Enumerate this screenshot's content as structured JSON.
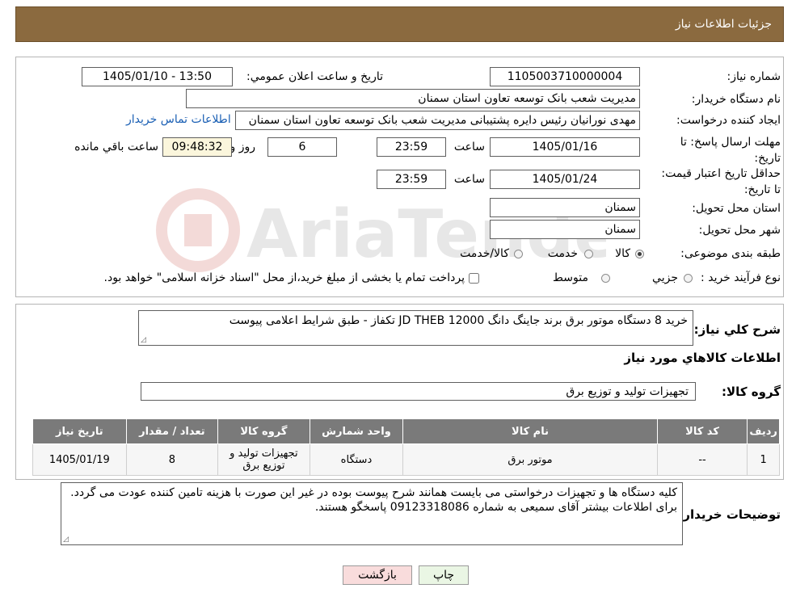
{
  "header": {
    "title": "جزئیات اطلاعات نیاز"
  },
  "form": {
    "need_number_label": "شماره نیاز:",
    "need_number": "1105003710000004",
    "announce_label": "تاریخ و ساعت اعلان عمومي:",
    "announce_value": "1405/01/10 - 13:50",
    "buyer_org_label": "نام دستگاه خریدار:",
    "buyer_org": "مدیریت شعب بانک توسعه تعاون استان سمنان",
    "creator_label": "ایجاد کننده درخواست:",
    "creator": "مهدی نورانیان رئیس دایره پشتیبانی مدیریت شعب بانک توسعه تعاون استان سمنان",
    "contact_link": "اطلاعات تماس خریدار",
    "deadline_label": "مهلت ارسال پاسخ: تا تاریخ:",
    "deadline_date": "1405/01/16",
    "time_label": "ساعت",
    "deadline_time": "23:59",
    "days_value": "6",
    "days_label": "روز و",
    "remaining_time": "09:48:32",
    "remaining_label": "ساعت باقي مانده",
    "validity_label": "حداقل تاریخ اعتبار قیمت: تا تاریخ:",
    "validity_date": "1405/01/24",
    "validity_time": "23:59",
    "province_label": "استان محل تحویل:",
    "province": "سمنان",
    "city_label": "شهر محل تحویل:",
    "city": "سمنان",
    "category_label": "طبقه بندی موضوعی:",
    "category_options": [
      "کالا",
      "خدمت",
      "کالا/خدمت"
    ],
    "process_label": "نوع فرآیند خرید :",
    "process_options": [
      "جزيي",
      "متوسط"
    ],
    "process_note": "پرداخت تمام یا بخشی از مبلغ خرید،از محل \"اسناد خزانه اسلامی\" خواهد بود."
  },
  "description": {
    "label": "شرح کلي نیاز:",
    "text": "خرید 8 دستگاه موتور برق برند جاینگ دانگ JD   THEB 12000 تکفاز -  طبق شرایط اعلامی پیوست"
  },
  "goods": {
    "section_title": "اطلاعات کالاهاي مورد نیاز",
    "group_label": "گروه کالا:",
    "group_value": "تجهیزات تولید و توزیع برق",
    "columns": [
      "ردیف",
      "کد کالا",
      "نام کالا",
      "واحد شمارش",
      "گروه کالا",
      "تعداد / مقدار",
      "تاریخ نیاز"
    ],
    "rows": [
      [
        "1",
        "--",
        "موتور برق",
        "دستگاه",
        "تجهیزات تولید و توزیع برق",
        "8",
        "1405/01/19"
      ]
    ]
  },
  "buyer_notes": {
    "label": "توضیحات خریدار:",
    "text": "کلیه دستگاه ها و تجهیزات درخواستی می بایست همانند شرح پیوست بوده در غیر این صورت با هزینه تامین کننده عودت می گردد. برای اطلاعات بیشتر آقای سمیعی به شماره 09123318086 پاسخگو هستند."
  },
  "buttons": {
    "print": "چاپ",
    "back": "بازگشت"
  },
  "watermark": {
    "text": "AriaTender.neT"
  },
  "colors": {
    "header_bg": "#8b6a3f",
    "link": "#1a5fb4",
    "table_header": "#7a7a7a"
  }
}
